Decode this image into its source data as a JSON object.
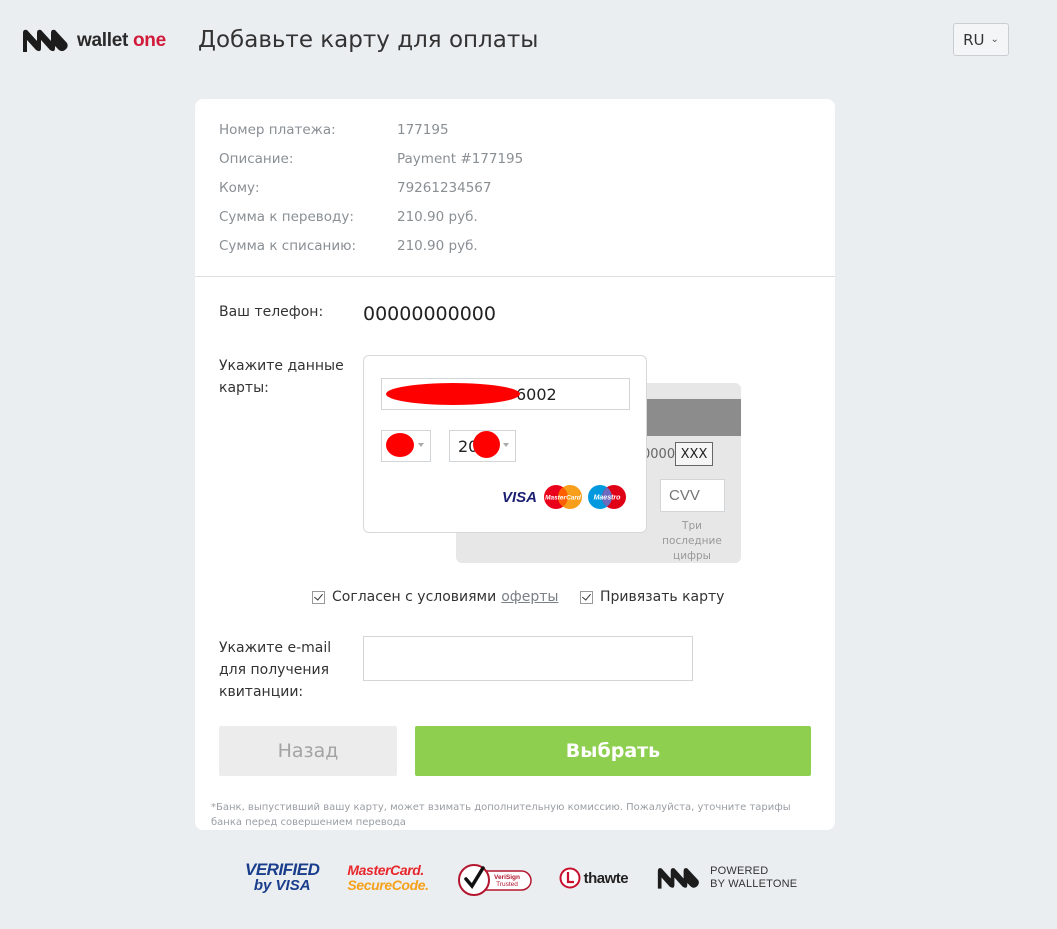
{
  "header": {
    "logo_text_1": "wallet",
    "logo_text_2": " one",
    "title": "Добавьте карту для оплаты",
    "language": "RU"
  },
  "payment_info": [
    {
      "label": "Номер платежа:",
      "value": "177195"
    },
    {
      "label": "Описание:",
      "value": "Payment #177195"
    },
    {
      "label": "Кому:",
      "value": "79261234567"
    },
    {
      "label": "Сумма к переводу:",
      "value": "210.90 руб."
    },
    {
      "label": "Сумма к списанию:",
      "value": "210.90 руб."
    }
  ],
  "phone": {
    "label": "Ваш телефон:",
    "value": "00000000000"
  },
  "card": {
    "label": "Укажите данные карты:",
    "number_visible_suffix": "6002",
    "year_prefix": "20",
    "back_digits": "0000",
    "back_code": "XXX",
    "cvv_placeholder": "CVV",
    "cvv_hint": "Три последние цифры",
    "brands": [
      "VISA",
      "MasterCard",
      "Maestro"
    ]
  },
  "agreements": {
    "terms_text": "Согласен с условиями",
    "terms_link": "оферты",
    "bind_card": "Привязать карту"
  },
  "email": {
    "label": "Укажите e-mail для получения квитанции:",
    "value": ""
  },
  "buttons": {
    "back": "Назад",
    "select": "Выбрать"
  },
  "note": "*Банк, выпустивший вашу карту, может взимать дополнительную комиссию. Пожалуйста, уточните тарифы банка перед совершением перевода",
  "footer": {
    "verified_l1": "VERIFIED",
    "verified_l2": "by VISA",
    "mc_l1": "MasterCard.",
    "mc_l2": "SecureCode.",
    "verisign": "VeriSign Trusted",
    "thawte": "thawte",
    "powered_l1": "POWERED",
    "powered_l2": "BY WALLETONE"
  },
  "colors": {
    "accent_green": "#8ecf4f",
    "brand_red": "#d11a3a",
    "background": "#ebeef1"
  }
}
